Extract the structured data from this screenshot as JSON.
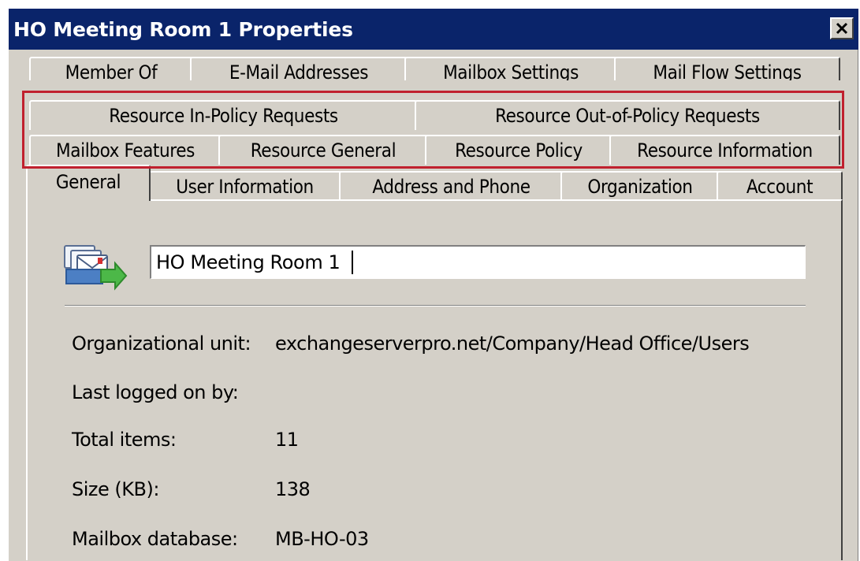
{
  "window": {
    "title": "HO Meeting Room 1 Properties",
    "close_label": "Close"
  },
  "tabs": {
    "row1": [
      "Member Of",
      "E-Mail Addresses",
      "Mailbox Settings",
      "Mail Flow Settings"
    ],
    "row2": [
      "Resource In-Policy Requests",
      "Resource Out-of-Policy Requests"
    ],
    "row3": [
      "Mailbox Features",
      "Resource General",
      "Resource Policy",
      "Resource Information"
    ],
    "row4": [
      "General",
      "User Information",
      "Address and Phone",
      "Organization",
      "Account"
    ],
    "active": "General"
  },
  "general": {
    "display_name": "HO Meeting Room 1",
    "fields": [
      {
        "label": "Organizational unit:",
        "value": "exchangeserverpro.net/Company/Head Office/Users"
      },
      {
        "label": "Last logged on by:",
        "value": ""
      },
      {
        "label": "Total items:",
        "value": "11"
      },
      {
        "label": "Size (KB):",
        "value": "138"
      },
      {
        "label": "Mailbox database:",
        "value": "MB-HO-03"
      }
    ]
  },
  "icons": {
    "mailbox": "mailbox-resource-icon",
    "close": "close-icon"
  },
  "colors": {
    "titlebar": "#0a246a",
    "dialog": "#d4d0c8",
    "highlight": "#c0202e"
  }
}
